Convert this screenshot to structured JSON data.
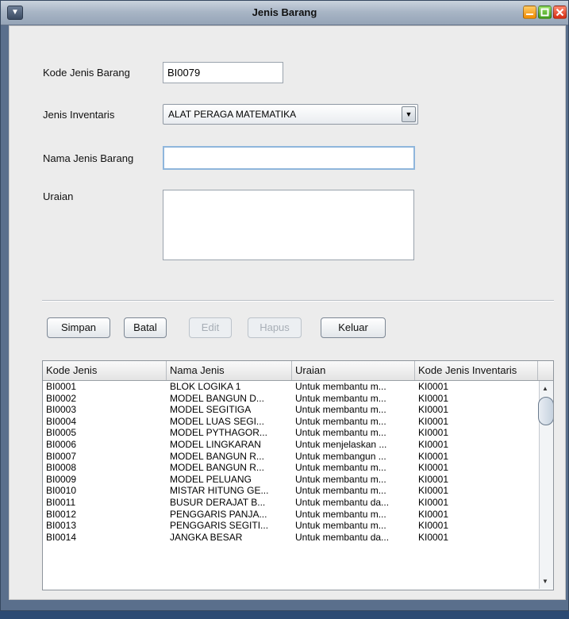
{
  "window": {
    "title": "Jenis Barang"
  },
  "form": {
    "kode_label": "Kode Jenis Barang",
    "kode_value": "BI0079",
    "inventaris_label": "Jenis Inventaris",
    "inventaris_value": "ALAT PERAGA MATEMATIKA",
    "nama_label": "Nama Jenis Barang",
    "nama_value": "",
    "uraian_label": "Uraian",
    "uraian_value": ""
  },
  "buttons": {
    "simpan": "Simpan",
    "batal": "Batal",
    "edit": "Edit",
    "hapus": "Hapus",
    "keluar": "Keluar"
  },
  "table": {
    "columns": [
      "Kode Jenis",
      "Nama Jenis",
      "Uraian",
      "Kode Jenis Inventaris"
    ],
    "rows": [
      [
        "BI0001",
        "BLOK LOGIKA 1",
        "Untuk membantu m...",
        "KI0001"
      ],
      [
        "BI0002",
        "MODEL BANGUN D...",
        "Untuk membantu m...",
        "KI0001"
      ],
      [
        "BI0003",
        "MODEL SEGITIGA",
        "Untuk membantu m...",
        "KI0001"
      ],
      [
        "BI0004",
        "MODEL LUAS SEGI...",
        "Untuk membantu m...",
        "KI0001"
      ],
      [
        "BI0005",
        "MODEL PYTHAGOR...",
        "Untuk membantu m...",
        "KI0001"
      ],
      [
        "BI0006",
        "MODEL LINGKARAN",
        "Untuk menjelaskan ...",
        "KI0001"
      ],
      [
        "BI0007",
        "MODEL BANGUN R...",
        "Untuk membangun ...",
        "KI0001"
      ],
      [
        "BI0008",
        "MODEL BANGUN R...",
        "Untuk membantu m...",
        "KI0001"
      ],
      [
        "BI0009",
        "MODEL PELUANG",
        "Untuk membantu m...",
        "KI0001"
      ],
      [
        "BI0010",
        "MISTAR HITUNG GE...",
        "Untuk membantu m...",
        "KI0001"
      ],
      [
        "BI0011",
        "BUSUR DERAJAT B...",
        "Untuk membantu da...",
        "KI0001"
      ],
      [
        "BI0012",
        "PENGGARIS PANJA...",
        "Untuk membantu m...",
        "KI0001"
      ],
      [
        "BI0013",
        "PENGGARIS SEGITI...",
        "Untuk membantu m...",
        "KI0001"
      ],
      [
        "BI0014",
        "JANGKA BESAR",
        "Untuk membantu da...",
        "KI0001"
      ]
    ]
  },
  "icons": {
    "system_menu": "window-menu-icon",
    "minimize": "minimize-icon",
    "maximize": "maximize-icon",
    "close": "close-icon"
  }
}
